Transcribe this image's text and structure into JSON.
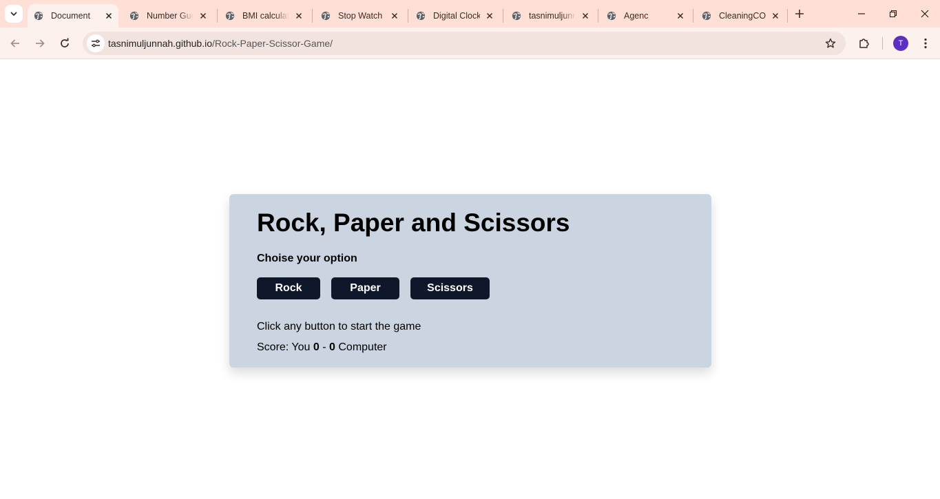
{
  "browser": {
    "tabs": [
      {
        "title": "Document",
        "active": true
      },
      {
        "title": "Number Guessing Game",
        "active": false
      },
      {
        "title": "BMI calculator",
        "active": false
      },
      {
        "title": "Stop Watch",
        "active": false
      },
      {
        "title": "Digital Clock",
        "active": false
      },
      {
        "title": "tasnimuljunnah",
        "active": false
      },
      {
        "title": "Agenc",
        "active": false
      },
      {
        "title": "CleaningCO",
        "active": false
      }
    ],
    "url_host": "tasnimuljunnah.github.io",
    "url_path": "/Rock-Paper-Scissor-Game/",
    "profile_initial": "T",
    "theme_color": "#ffdfd6"
  },
  "game": {
    "title": "Rock, Paper and Scissors",
    "subtitle": "Choise your option",
    "buttons": {
      "rock": "Rock",
      "paper": "Paper",
      "scissors": "Scissors"
    },
    "message": "Click any button to start the game",
    "score": {
      "prefix": "Score: You",
      "you": "0",
      "separator": "-",
      "computer": "0",
      "suffix": "Computer"
    },
    "card_color": "#cbd5e1",
    "button_color": "#0f172a"
  }
}
